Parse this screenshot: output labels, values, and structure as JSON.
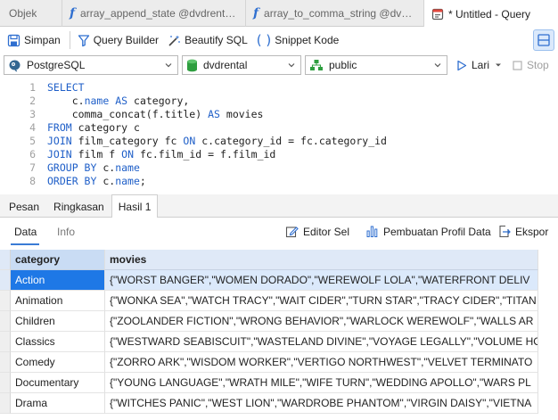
{
  "tabs": [
    {
      "label": "Objek",
      "icon": ""
    },
    {
      "label": "array_append_state @dvdrental...",
      "icon": "function-icon"
    },
    {
      "label": "array_to_comma_string @dvdr...",
      "icon": "function-icon"
    },
    {
      "label": "* Untitled - Query",
      "icon": "query-icon"
    }
  ],
  "toolbar": {
    "save_label": "Simpan",
    "query_builder_label": "Query Builder",
    "beautify_label": "Beautify SQL",
    "snippet_label": "Snippet Kode"
  },
  "connection": {
    "type": "PostgreSQL",
    "database": "dvdrental",
    "schema": "public",
    "run_label": "Lari",
    "stop_label": "Stop"
  },
  "editor": {
    "line_numbers": [
      "1",
      "2",
      "3",
      "4",
      "5",
      "6",
      "7",
      "8"
    ]
  },
  "result_tabs": [
    "Pesan",
    "Ringkasan",
    "Hasil 1"
  ],
  "subbar": {
    "data_label": "Data",
    "info_label": "Info",
    "editor_label": "Editor Sel",
    "profile_label": "Pembuatan Profil Data",
    "export_label": "Ekspor"
  },
  "grid": {
    "columns": [
      "category",
      "movies"
    ],
    "rows": [
      {
        "category": "Action",
        "movies": "{\"WORST BANGER\",\"WOMEN DORADO\",\"WEREWOLF LOLA\",\"WATERFRONT DELIV"
      },
      {
        "category": "Animation",
        "movies": "{\"WONKA SEA\",\"WATCH TRACY\",\"WAIT CIDER\",\"TURN STAR\",\"TRACY CIDER\",\"TITAN"
      },
      {
        "category": "Children",
        "movies": "{\"ZOOLANDER FICTION\",\"WRONG BEHAVIOR\",\"WARLOCK WEREWOLF\",\"WALLS AR"
      },
      {
        "category": "Classics",
        "movies": "{\"WESTWARD SEABISCUIT\",\"WASTELAND DIVINE\",\"VOYAGE LEGALLY\",\"VOLUME HO"
      },
      {
        "category": "Comedy",
        "movies": "{\"ZORRO ARK\",\"WISDOM WORKER\",\"VERTIGO NORTHWEST\",\"VELVET TERMINATO"
      },
      {
        "category": "Documentary",
        "movies": "{\"YOUNG LANGUAGE\",\"WRATH MILE\",\"WIFE TURN\",\"WEDDING APOLLO\",\"WARS PL"
      },
      {
        "category": "Drama",
        "movies": "{\"WITCHES PANIC\",\"WEST LION\",\"WARDROBE PHANTOM\",\"VIRGIN DAISY\",\"VIETNA"
      }
    ]
  },
  "colors": {
    "accent": "#1e78e6",
    "keyword": "#1f5fc8",
    "header_bg": "#dfe9f7"
  }
}
